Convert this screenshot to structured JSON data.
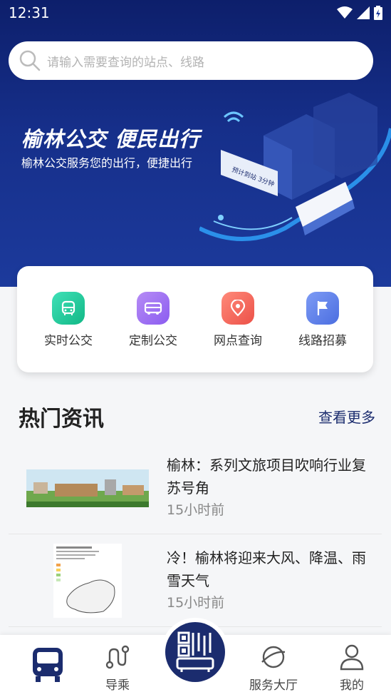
{
  "status": {
    "time": "12:31"
  },
  "search": {
    "placeholder": "请输入需要查询的站点、线路"
  },
  "banner": {
    "title": "榆林公交 便民出行",
    "subtitle": "榆林公交服务您的出行，便捷出行"
  },
  "quick_actions": [
    {
      "label": "实时公交",
      "icon": "bus-icon",
      "color": "#20c49a"
    },
    {
      "label": "定制公交",
      "icon": "custom-bus-icon",
      "color": "#9b6be6"
    },
    {
      "label": "网点查询",
      "icon": "location-pin-icon",
      "color": "#f06a5e"
    },
    {
      "label": "线路招募",
      "icon": "flag-icon",
      "color": "#5b7fe8"
    }
  ],
  "news_section": {
    "title": "热门资讯",
    "more": "查看更多"
  },
  "news": [
    {
      "title": "榆林：系列文旅项目吹响行业复苏号角",
      "time": "15小时前"
    },
    {
      "title": "冷！榆林将迎来大风、降温、雨雪天气",
      "time": "15小时前"
    }
  ],
  "tabs": [
    {
      "label": "",
      "icon": "bus-icon"
    },
    {
      "label": "导乘",
      "icon": "route-icon"
    },
    {
      "label": "",
      "icon": "qr-code-icon"
    },
    {
      "label": "服务大厅",
      "icon": "planet-icon"
    },
    {
      "label": "我的",
      "icon": "person-icon"
    }
  ],
  "colors": {
    "primary": "#1b2c6e",
    "hero": "#162f8a"
  }
}
